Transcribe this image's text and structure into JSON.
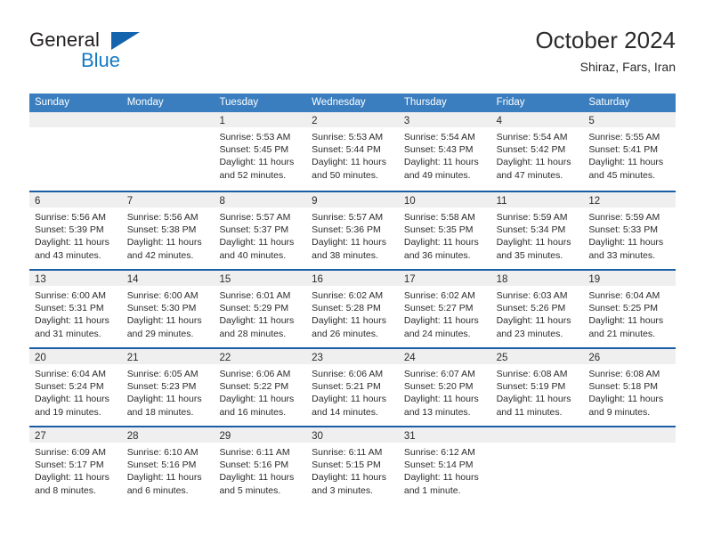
{
  "brand": {
    "name_top": "General",
    "name_bottom": "Blue",
    "triangle_icon": "triangle-icon",
    "color_dark": "#231f20",
    "color_blue": "#1479c4"
  },
  "header": {
    "title": "October 2024",
    "subtitle": "Shiraz, Fars, Iran"
  },
  "theme": {
    "header_bg": "#3a7ebf",
    "row_divider": "#1b5ea6",
    "day_band_bg": "#efefef"
  },
  "calendar": {
    "weekdays": [
      "Sunday",
      "Monday",
      "Tuesday",
      "Wednesday",
      "Thursday",
      "Friday",
      "Saturday"
    ],
    "weeks": [
      [
        {
          "day": "",
          "empty": true
        },
        {
          "day": "",
          "empty": true
        },
        {
          "day": "1",
          "sunrise": "Sunrise: 5:53 AM",
          "sunset": "Sunset: 5:45 PM",
          "daylight1": "Daylight: 11 hours",
          "daylight2": "and 52 minutes."
        },
        {
          "day": "2",
          "sunrise": "Sunrise: 5:53 AM",
          "sunset": "Sunset: 5:44 PM",
          "daylight1": "Daylight: 11 hours",
          "daylight2": "and 50 minutes."
        },
        {
          "day": "3",
          "sunrise": "Sunrise: 5:54 AM",
          "sunset": "Sunset: 5:43 PM",
          "daylight1": "Daylight: 11 hours",
          "daylight2": "and 49 minutes."
        },
        {
          "day": "4",
          "sunrise": "Sunrise: 5:54 AM",
          "sunset": "Sunset: 5:42 PM",
          "daylight1": "Daylight: 11 hours",
          "daylight2": "and 47 minutes."
        },
        {
          "day": "5",
          "sunrise": "Sunrise: 5:55 AM",
          "sunset": "Sunset: 5:41 PM",
          "daylight1": "Daylight: 11 hours",
          "daylight2": "and 45 minutes."
        }
      ],
      [
        {
          "day": "6",
          "sunrise": "Sunrise: 5:56 AM",
          "sunset": "Sunset: 5:39 PM",
          "daylight1": "Daylight: 11 hours",
          "daylight2": "and 43 minutes."
        },
        {
          "day": "7",
          "sunrise": "Sunrise: 5:56 AM",
          "sunset": "Sunset: 5:38 PM",
          "daylight1": "Daylight: 11 hours",
          "daylight2": "and 42 minutes."
        },
        {
          "day": "8",
          "sunrise": "Sunrise: 5:57 AM",
          "sunset": "Sunset: 5:37 PM",
          "daylight1": "Daylight: 11 hours",
          "daylight2": "and 40 minutes."
        },
        {
          "day": "9",
          "sunrise": "Sunrise: 5:57 AM",
          "sunset": "Sunset: 5:36 PM",
          "daylight1": "Daylight: 11 hours",
          "daylight2": "and 38 minutes."
        },
        {
          "day": "10",
          "sunrise": "Sunrise: 5:58 AM",
          "sunset": "Sunset: 5:35 PM",
          "daylight1": "Daylight: 11 hours",
          "daylight2": "and 36 minutes."
        },
        {
          "day": "11",
          "sunrise": "Sunrise: 5:59 AM",
          "sunset": "Sunset: 5:34 PM",
          "daylight1": "Daylight: 11 hours",
          "daylight2": "and 35 minutes."
        },
        {
          "day": "12",
          "sunrise": "Sunrise: 5:59 AM",
          "sunset": "Sunset: 5:33 PM",
          "daylight1": "Daylight: 11 hours",
          "daylight2": "and 33 minutes."
        }
      ],
      [
        {
          "day": "13",
          "sunrise": "Sunrise: 6:00 AM",
          "sunset": "Sunset: 5:31 PM",
          "daylight1": "Daylight: 11 hours",
          "daylight2": "and 31 minutes."
        },
        {
          "day": "14",
          "sunrise": "Sunrise: 6:00 AM",
          "sunset": "Sunset: 5:30 PM",
          "daylight1": "Daylight: 11 hours",
          "daylight2": "and 29 minutes."
        },
        {
          "day": "15",
          "sunrise": "Sunrise: 6:01 AM",
          "sunset": "Sunset: 5:29 PM",
          "daylight1": "Daylight: 11 hours",
          "daylight2": "and 28 minutes."
        },
        {
          "day": "16",
          "sunrise": "Sunrise: 6:02 AM",
          "sunset": "Sunset: 5:28 PM",
          "daylight1": "Daylight: 11 hours",
          "daylight2": "and 26 minutes."
        },
        {
          "day": "17",
          "sunrise": "Sunrise: 6:02 AM",
          "sunset": "Sunset: 5:27 PM",
          "daylight1": "Daylight: 11 hours",
          "daylight2": "and 24 minutes."
        },
        {
          "day": "18",
          "sunrise": "Sunrise: 6:03 AM",
          "sunset": "Sunset: 5:26 PM",
          "daylight1": "Daylight: 11 hours",
          "daylight2": "and 23 minutes."
        },
        {
          "day": "19",
          "sunrise": "Sunrise: 6:04 AM",
          "sunset": "Sunset: 5:25 PM",
          "daylight1": "Daylight: 11 hours",
          "daylight2": "and 21 minutes."
        }
      ],
      [
        {
          "day": "20",
          "sunrise": "Sunrise: 6:04 AM",
          "sunset": "Sunset: 5:24 PM",
          "daylight1": "Daylight: 11 hours",
          "daylight2": "and 19 minutes."
        },
        {
          "day": "21",
          "sunrise": "Sunrise: 6:05 AM",
          "sunset": "Sunset: 5:23 PM",
          "daylight1": "Daylight: 11 hours",
          "daylight2": "and 18 minutes."
        },
        {
          "day": "22",
          "sunrise": "Sunrise: 6:06 AM",
          "sunset": "Sunset: 5:22 PM",
          "daylight1": "Daylight: 11 hours",
          "daylight2": "and 16 minutes."
        },
        {
          "day": "23",
          "sunrise": "Sunrise: 6:06 AM",
          "sunset": "Sunset: 5:21 PM",
          "daylight1": "Daylight: 11 hours",
          "daylight2": "and 14 minutes."
        },
        {
          "day": "24",
          "sunrise": "Sunrise: 6:07 AM",
          "sunset": "Sunset: 5:20 PM",
          "daylight1": "Daylight: 11 hours",
          "daylight2": "and 13 minutes."
        },
        {
          "day": "25",
          "sunrise": "Sunrise: 6:08 AM",
          "sunset": "Sunset: 5:19 PM",
          "daylight1": "Daylight: 11 hours",
          "daylight2": "and 11 minutes."
        },
        {
          "day": "26",
          "sunrise": "Sunrise: 6:08 AM",
          "sunset": "Sunset: 5:18 PM",
          "daylight1": "Daylight: 11 hours",
          "daylight2": "and 9 minutes."
        }
      ],
      [
        {
          "day": "27",
          "sunrise": "Sunrise: 6:09 AM",
          "sunset": "Sunset: 5:17 PM",
          "daylight1": "Daylight: 11 hours",
          "daylight2": "and 8 minutes."
        },
        {
          "day": "28",
          "sunrise": "Sunrise: 6:10 AM",
          "sunset": "Sunset: 5:16 PM",
          "daylight1": "Daylight: 11 hours",
          "daylight2": "and 6 minutes."
        },
        {
          "day": "29",
          "sunrise": "Sunrise: 6:11 AM",
          "sunset": "Sunset: 5:16 PM",
          "daylight1": "Daylight: 11 hours",
          "daylight2": "and 5 minutes."
        },
        {
          "day": "30",
          "sunrise": "Sunrise: 6:11 AM",
          "sunset": "Sunset: 5:15 PM",
          "daylight1": "Daylight: 11 hours",
          "daylight2": "and 3 minutes."
        },
        {
          "day": "31",
          "sunrise": "Sunrise: 6:12 AM",
          "sunset": "Sunset: 5:14 PM",
          "daylight1": "Daylight: 11 hours",
          "daylight2": "and 1 minute."
        },
        {
          "day": "",
          "empty": true
        },
        {
          "day": "",
          "empty": true
        }
      ]
    ]
  }
}
